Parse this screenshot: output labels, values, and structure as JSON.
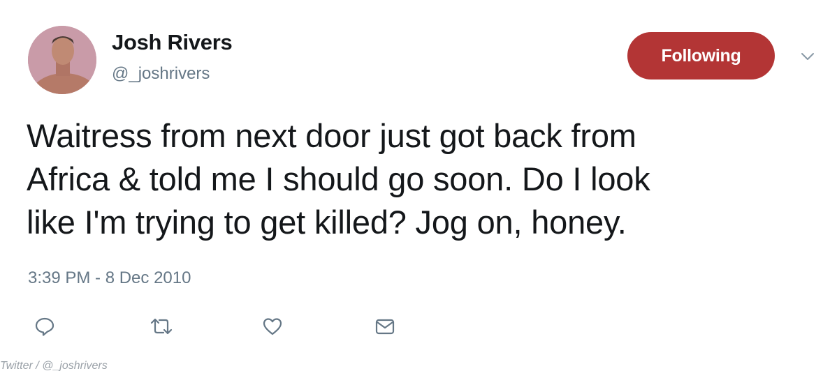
{
  "author": {
    "display_name": "Josh Rivers",
    "handle": "@_joshrivers",
    "avatar_icon": "profile-photo"
  },
  "follow_button": {
    "label": "Following",
    "color": "#b33535"
  },
  "caret_icon": "chevron-down-icon",
  "tweet": {
    "text": "Waitress from next door just got back from\nAfrica & told me I should go soon. Do I look\nlike I'm trying to get killed? Jog on, honey.",
    "timestamp": "3:39 PM - 8 Dec 2010"
  },
  "actions": [
    {
      "name": "reply",
      "icon": "reply-icon"
    },
    {
      "name": "retweet",
      "icon": "retweet-icon"
    },
    {
      "name": "like",
      "icon": "heart-icon"
    },
    {
      "name": "message",
      "icon": "envelope-icon"
    }
  ],
  "caption": "Twitter / @_joshrivers",
  "colors": {
    "text": "#14171a",
    "secondary": "#657786",
    "accent": "#b33535"
  }
}
